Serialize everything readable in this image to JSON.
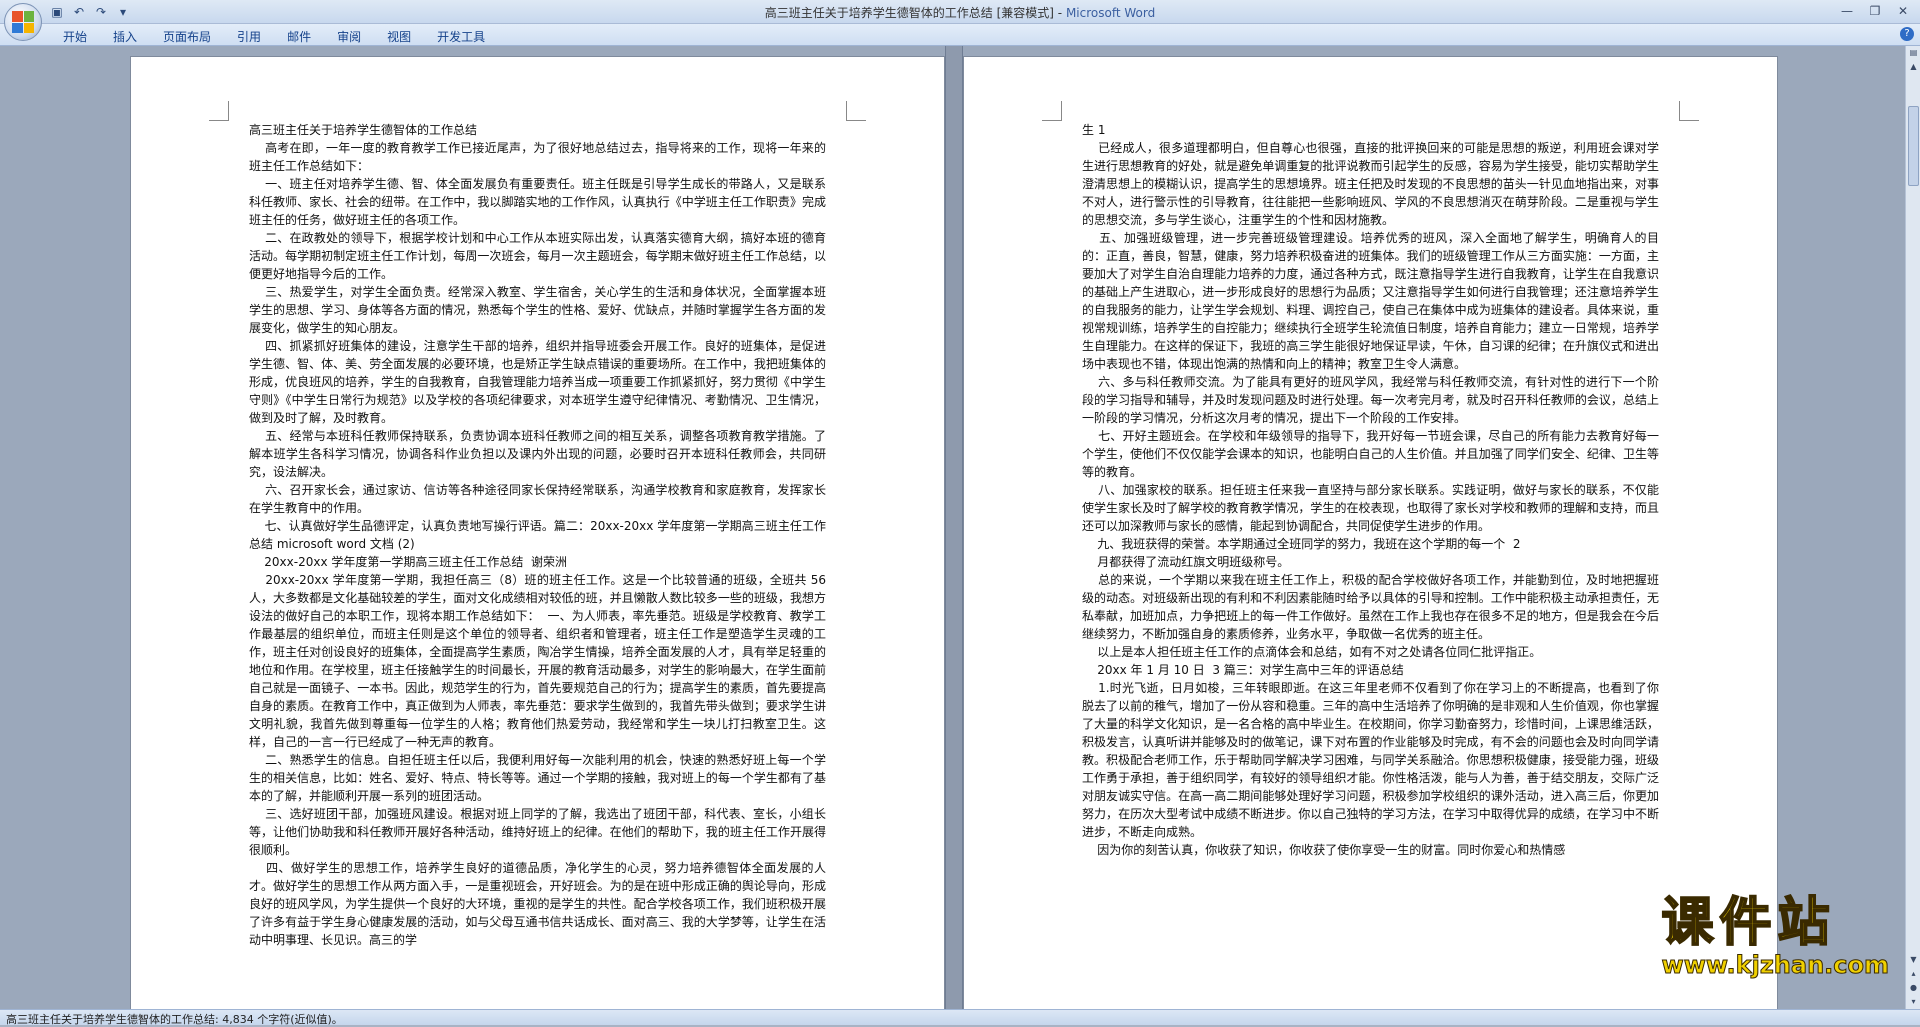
{
  "window": {
    "title": "高三班主任关于培养学生德智体的工作总结 [兼容模式]",
    "app_name": "Microsoft Word"
  },
  "ribbon": {
    "tabs": [
      "开始",
      "插入",
      "页面布局",
      "引用",
      "邮件",
      "审阅",
      "视图",
      "开发工具"
    ]
  },
  "document": {
    "left_page_text": "高三班主任关于培养学生德智体的工作总结\n    高考在即，一年一度的教育教学工作已接近尾声，为了很好地总结过去，指导将来的工作，现将一年来的班主任工作总结如下：\n    一、班主任对培养学生德、智、体全面发展负有重要责任。班主任既是引导学生成长的带路人，又是联系科任教师、家长、社会的纽带。在工作中，我以脚踏实地的工作作风，认真执行《中学班主任工作职责》完成班主任的任务，做好班主任的各项工作。\n    二、在政教处的领导下，根据学校计划和中心工作从本班实际出发，认真落实德育大纲，搞好本班的德育活动。每学期初制定班主任工作计划，每周一次班会，每月一次主题班会，每学期末做好班主任工作总结，以便更好地指导今后的工作。\n    三、热爱学生，对学生全面负责。经常深入教室、学生宿舍，关心学生的生活和身体状况，全面掌握本班学生的思想、学习、身体等各方面的情况，熟悉每个学生的性格、爱好、优缺点，并随时掌握学生各方面的发展变化，做学生的知心朋友。\n    四、抓紧抓好班集体的建设，注意学生干部的培养，组织并指导班委会开展工作。良好的班集体，是促进学生德、智、体、美、劳全面发展的必要环境，也是矫正学生缺点错误的重要场所。在工作中，我把班集体的形成，优良班风的培养，学生的自我教育，自我管理能力培养当成一项重要工作抓紧抓好，努力贯彻《中学生守则》《中学生日常行为规范》以及学校的各项纪律要求，对本班学生遵守纪律情况、考勤情况、卫生情况，做到及时了解，及时教育。\n    五、经常与本班科任教师保持联系，负责协调本班科任教师之间的相互关系，调整各项教育教学措施。了解本班学生各科学习情况，协调各科作业负担以及课内外出现的问题，必要时召开本班科任教师会，共同研究，设法解决。\n    六、召开家长会，通过家访、信访等各种途径同家长保持经常联系，沟通学校教育和家庭教育，发挥家长在学生教育中的作用。\n    七、认真做好学生品德评定，认真负责地写操行评语。篇二：20xx-20xx 学年度第一学期高三班主任工作总结 microsoft word 文档 (2)\n    20xx-20xx 学年度第一学期高三班主任工作总结  谢荣洲\n    20xx-20xx 学年度第一学期，我担任高三（8）班的班主任工作。这是一个比较普通的班级，全班共 56 人，大多数都是文化基础较差的学生，面对文化成绩相对较低的班，并且懒散人数比较多一些的班级，我想方设法的做好自己的本职工作，现将本期工作总结如下：  一、为人师表，率先垂范。班级是学校教育、教学工作最基层的组织单位，而班主任则是这个单位的领导者、组织者和管理者，班主任工作是塑造学生灵魂的工作，班主任对创设良好的班集体，全面提高学生素质，陶冶学生情操，培养全面发展的人才，具有举足轻重的地位和作用。在学校里，班主任接触学生的时间最长，开展的教育活动最多，对学生的影响最大，在学生面前自己就是一面镜子、一本书。因此，规范学生的行为，首先要规范自己的行为；提高学生的素质，首先要提高自身的素质。在教育工作中，真正做到为人师表，率先垂范：要求学生做到的，我首先带头做到；要求学生讲文明礼貌，我首先做到尊重每一位学生的人格；教育他们热爱劳动，我经常和学生一块儿打扫教室卫生。这样，自己的一言一行已经成了一种无声的教育。\n    二、熟悉学生的信息。自担任班主任以后，我便利用好每一次能利用的机会，快速的熟悉好班上每一个学生的相关信息，比如：姓名、爱好、特点、特长等等。通过一个学期的接触，我对班上的每一个学生都有了基本的了解，并能顺利开展一系列的班团活动。\n    三、选好班团干部，加强班风建设。根据对班上同学的了解，我选出了班团干部，科代表、室长，小组长等，让他们协助我和科任教师开展好各种活动，维持好班上的纪律。在他们的帮助下，我的班主任工作开展得很顺利。\n    四、做好学生的思想工作，培养学生良好的道德品质，净化学生的心灵，努力培养德智体全面发展的人才。做好学生的思想工作从两方面入手，一是重视班会，开好班会。为的是在班中形成正确的舆论导向，形成良好的班风学风，为学生提供一个良好的大环境，重视的是学生的共性。配合学校各项工作，我们班积极开展了许多有益于学生身心健康发展的活动，如与父母互通书信共话成长、面对高三、我的大学梦等，让学生在活动中明事理、长见识。高三的学",
    "right_page_text": "生 1\n    已经成人，很多道理都明白，但自尊心也很强，直接的批评换回来的可能是思想的叛逆，利用班会课对学生进行思想教育的好处，就是避免单调重复的批评说教而引起学生的反感，容易为学生接受，能切实帮助学生澄清思想上的模糊认识，提高学生的思想境界。班主任把及时发现的不良思想的苗头一针见血地指出来，对事不对人，进行警示性的引导教育，往往能把一些影响班风、学风的不良思想消灭在萌芽阶段。二是重视与学生的思想交流，多与学生谈心，注重学生的个性和因材施教。\n    五、加强班级管理，进一步完善班级管理建设。培养优秀的班风，深入全面地了解学生，明确育人的目的：正直，善良，智慧，健康，努力培养积极奋进的班集体。我们的班级管理工作从三方面实施：一方面，主要加大了对学生自治自理能力培养的力度，通过各种方式，既注意指导学生进行自我教育，让学生在自我意识的基础上产生进取心，进一步形成良好的思想行为品质；又注意指导学生如何进行自我管理；还注意培养学生的自我服务的能力，让学生学会规划、料理、调控自己，使自己在集体中成为班集体的建设者。具体来说，重视常规训练，培养学生的自控能力；继续执行全班学生轮流值日制度，培养自育能力；建立一日常规，培养学生自理能力。在这样的保证下，我班的高三学生能很好地保证早读，午休，自习课的纪律；在升旗仪式和进出场中表现也不错，体现出饱满的热情和向上的精神；教室卫生令人满意。\n    六、多与科任教师交流。为了能具有更好的班风学风，我经常与科任教师交流，有针对性的进行下一个阶段的学习指导和辅导，并及时发现问题及时进行处理。每一次考完月考，就及时召开科任教师的会议，总结上一阶段的学习情况，分析这次月考的情况，提出下一个阶段的工作安排。\n    七、开好主题班会。在学校和年级领导的指导下，我开好每一节班会课，尽自己的所有能力去教育好每一个学生，使他们不仅仅能学会课本的知识，也能明白自己的人生价值。并且加强了同学们安全、纪律、卫生等等的教育。\n    八、加强家校的联系。担任班主任来我一直坚持与部分家长联系。实践证明，做好与家长的联系，不仅能使学生家长及时了解学校的教育教学情况，学生的在校表现，也取得了家长对学校和教师的理解和支持，而且还可以加深教师与家长的感情，能起到协调配合，共同促使学生进步的作用。\n    九、我班获得的荣誉。本学期通过全班同学的努力，我班在这个学期的每一个  2\n    月都获得了流动红旗文明班级称号。\n    总的来说，一个学期以来我在班主任工作上，积极的配合学校做好各项工作，并能勤到位，及时地把握班级的动态。对班级新出现的有利和不利因素能随时给予以具体的引导和控制。工作中能积极主动承担责任，无私奉献，加班加点，力争把班上的每一件工作做好。虽然在工作上我也存在很多不足的地方，但是我会在今后继续努力，不断加强自身的素质修养，业务水平，争取做一名优秀的班主任。\n    以上是本人担任班主任工作的点滴体会和总结，如有不对之处请各位同仁批评指正。\n    20xx 年 1 月 10 日  3 篇三：对学生高中三年的评语总结\n    1.时光飞逝，日月如梭，三年转眼即逝。在这三年里老师不仅看到了你在学习上的不断提高，也看到了你脱去了以前的稚气，增加了一份从容和稳重。三年的高中生活培养了你明确的是非观和人生价值观，你也掌握了大量的科学文化知识，是一名合格的高中毕业生。在校期间，你学习勤奋努力，珍惜时间，上课思维活跃，积极发言，认真听讲并能够及时的做笔记，课下对布置的作业能够及时完成，有不会的问题也会及时向同学请教。积极配合老师工作，乐于帮助同学解决学习困难，与同学关系融洽。你思想积极健康，接受能力强，班级工作勇于承担，善于组织同学，有较好的领导组织才能。你性格活泼，能与人为善，善于结交朋友，交际广泛对朋友诚实守信。在高一高二期间能够处理好学习问题，积极参加学校组织的课外活动，进入高三后，你更加努力，在历次大型考试中成绩不断进步。你以自己独特的学习方法，在学习中取得优异的成绩，在学习中不断进步，不断走向成熟。\n    因为你的刻苦认真，你收获了知识，你收获了使你享受一生的财富。同时你爱心和热情感"
  },
  "statusbar": {
    "text": "高三班主任关于培养学生德智体的工作总结: 4,834 个字符(近似值)。"
  },
  "watermark": {
    "title": "课件站",
    "url": "www.kjzhan.com"
  }
}
